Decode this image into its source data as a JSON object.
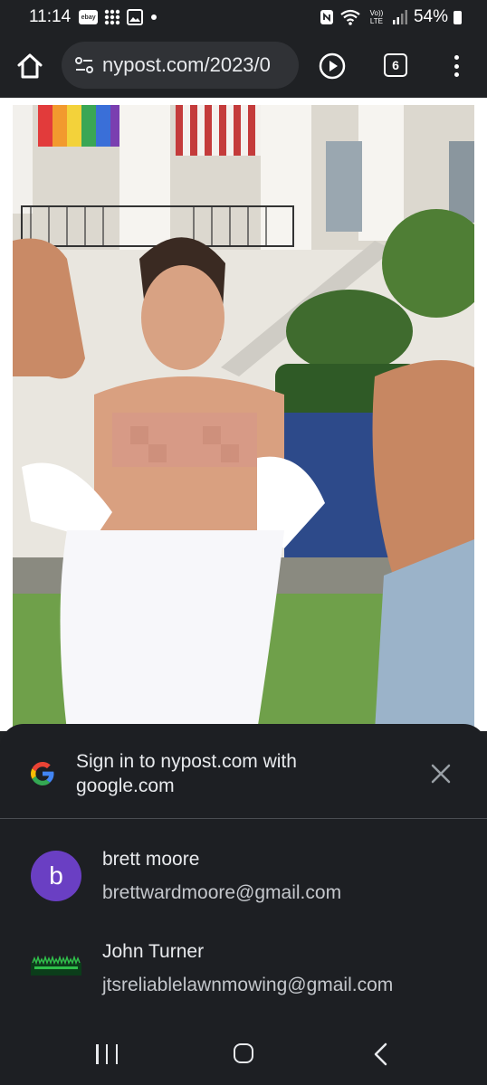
{
  "status_bar": {
    "time": "11:14",
    "left_icons": [
      "ebay-icon",
      "app-grid-icon",
      "gallery-icon",
      "dot-icon"
    ],
    "right_icons": [
      "nfc-icon",
      "wifi-icon",
      "volte-icon",
      "signal-icon"
    ],
    "volte_label": "Vo)) LTE",
    "battery_percent": "54%",
    "ebay_label": "ebay"
  },
  "toolbar": {
    "url": "nypost.com/2023/0",
    "tab_count": "6"
  },
  "sign_in_sheet": {
    "title": "Sign in to nypost.com with google.com",
    "accounts": [
      {
        "avatar_letter": "b",
        "avatar_color": "#6a3fc3",
        "name": "brett moore",
        "email": "brettwardmoore@gmail.com"
      },
      {
        "avatar_letter": "",
        "avatar_color": "#1b7d3b",
        "name": "John Turner",
        "email": "jtsreliablelawnmowing@gmail.com"
      }
    ]
  },
  "colors": {
    "background": "#1f2124",
    "sheet": "#1d1f23",
    "url_pill": "#303236"
  }
}
